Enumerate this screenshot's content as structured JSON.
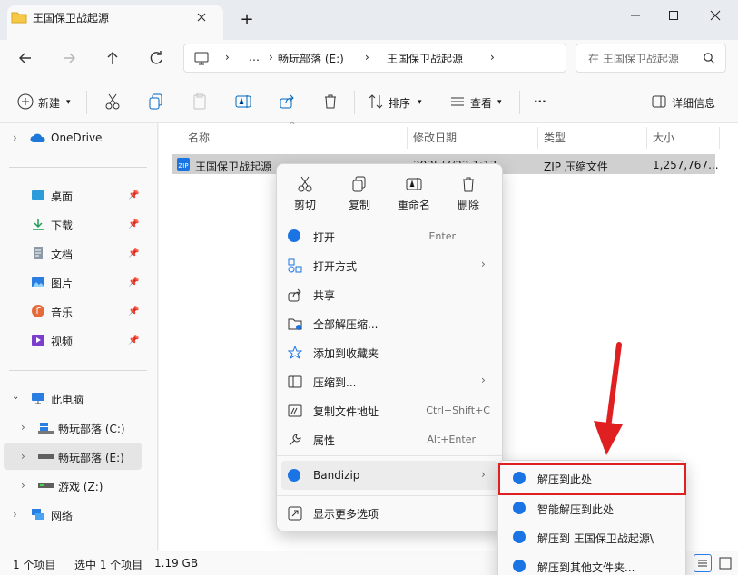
{
  "tab": {
    "title": "王国保卫战起源"
  },
  "window": {
    "new_tab": "+"
  },
  "address": {
    "segments": [
      "…",
      "畅玩部落 (E:)",
      "王国保卫战起源"
    ],
    "search_placeholder": "在 王国保卫战起源"
  },
  "commands": {
    "new_label": "新建",
    "sort_label": "排序",
    "view_label": "查看",
    "more_label": "···",
    "details_label": "详细信息"
  },
  "sidebar": {
    "onedrive": "OneDrive",
    "quick_access": [
      "桌面",
      "下载",
      "文档",
      "图片",
      "音乐",
      "视频"
    ],
    "this_pc": "此电脑",
    "drives": [
      "畅玩部落 (C:)",
      "畅玩部落 (E:)",
      "游戏 (Z:)"
    ],
    "network": "网络"
  },
  "columns": {
    "name": "名称",
    "modified": "修改日期",
    "type": "类型",
    "size": "大小"
  },
  "file": {
    "name": "王国保卫战起源",
    "modified": "2025/7/22 1:13",
    "type": "ZIP 压缩文件",
    "size": "1,257,767..."
  },
  "context_menu": {
    "top_actions": [
      "剪切",
      "复制",
      "重命名",
      "删除"
    ],
    "items": [
      {
        "label": "打开",
        "shortcut": "Enter"
      },
      {
        "label": "打开方式",
        "shortcut": ""
      },
      {
        "label": "共享",
        "shortcut": ""
      },
      {
        "label": "全部解压缩...",
        "shortcut": ""
      },
      {
        "label": "添加到收藏夹",
        "shortcut": ""
      },
      {
        "label": "压缩到...",
        "shortcut": ""
      },
      {
        "label": "复制文件地址",
        "shortcut": "Ctrl+Shift+C"
      },
      {
        "label": "属性",
        "shortcut": "Alt+Enter"
      },
      {
        "label": "Bandizip",
        "shortcut": ""
      },
      {
        "label": "显示更多选项",
        "shortcut": ""
      }
    ]
  },
  "submenu": {
    "items": [
      "解压到此处",
      "智能解压到此处",
      "解压到 王国保卫战起源\\",
      "解压到其他文件夹..."
    ]
  },
  "status": {
    "count": "1 个项目",
    "selected": "选中 1 个项目",
    "size": "1.19 GB"
  },
  "colors": {
    "accent": "#0067c0",
    "arrow": "#e02020",
    "bandizip": "#1b74e4"
  }
}
